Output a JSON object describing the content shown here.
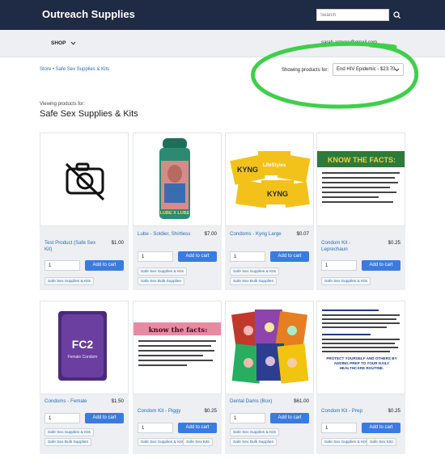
{
  "header": {
    "brand": "Outreach Supplies",
    "search_placeholder": "Search"
  },
  "nav": {
    "shop_label": "SHOP",
    "user_email": "sarah.armore@gmail.com"
  },
  "breadcrumb": "Store • Safe Sex Supplies & Kits",
  "filter": {
    "label": "Showing products for:",
    "selected": "End HIV Epidemic - $23.70"
  },
  "page": {
    "viewing_label": "Viewing products for:",
    "title": "Safe Sex Supplies & Kits"
  },
  "products": [
    {
      "name": "Test Product (Safe Sex Kit)",
      "price": "$1.00",
      "qty": "1",
      "button": "Add to cart",
      "tags": [
        "Safe Sex Supplies & Kits"
      ]
    },
    {
      "name": "Lube - Soldier, Shirtless",
      "price": "$7.00",
      "qty": "1",
      "button": "Add to cart",
      "tags": [
        "Safe Sex Supplies & Kits",
        "Safe Sex Bulk Supplies"
      ]
    },
    {
      "name": "Condoms - Kyng Large",
      "price": "$0.07",
      "qty": "1",
      "button": "Add to cart",
      "tags": [
        "Safe Sex Supplies & Kits",
        "Safe Sex Bulk Supplies"
      ]
    },
    {
      "name": "Condom Kit - Leprechaun",
      "price": "$0.25",
      "qty": "1",
      "button": "Add to cart",
      "tags": [
        "Safe Sex Supplies & Kits"
      ]
    },
    {
      "name": "Condoms - Female",
      "price": "$1.50",
      "qty": "1",
      "button": "Add to cart",
      "tags": [
        "Safe Sex Supplies & Kits",
        "Safe Sex Bulk Supplies"
      ]
    },
    {
      "name": "Condom Kit - Piggy",
      "price": "$0.25",
      "qty": "1",
      "button": "Add to cart",
      "tags": [
        "Safe Sex Supplies & Kits",
        "Safe Sex Kits"
      ]
    },
    {
      "name": "Dental Dams (Box)",
      "price": "$61.00",
      "qty": "1",
      "button": "Add to cart",
      "tags": [
        "Safe Sex Supplies & Kits",
        "Safe Sex Bulk Supplies"
      ]
    },
    {
      "name": "Condom Kit - Prep",
      "price": "$0.25",
      "qty": "1",
      "button": "Add to cart",
      "tags": [
        "Safe Sex Supplies & Kits",
        "Safe Sex Kits"
      ]
    }
  ],
  "images": {
    "lube_label": "LUBE X LUBE",
    "kyng_brand": "KYNG",
    "lifestyles_brand": "LifeStyles",
    "fc2_label": "FC2",
    "fc2_sub": "Female Condom",
    "know_facts_green": "KNOW THE FACTS:",
    "know_facts_pink": "know the facts:",
    "prep_heading": "PROTECT YOURSELF AND OTHERS BY ADDING PREP TO YOUR DAILY HEALTHCARE ROUTINE."
  },
  "colors": {
    "topbar": "#1f2a44",
    "accent": "#3a7be0",
    "link": "#2b6cb0",
    "annotation": "#3ecf4a"
  }
}
